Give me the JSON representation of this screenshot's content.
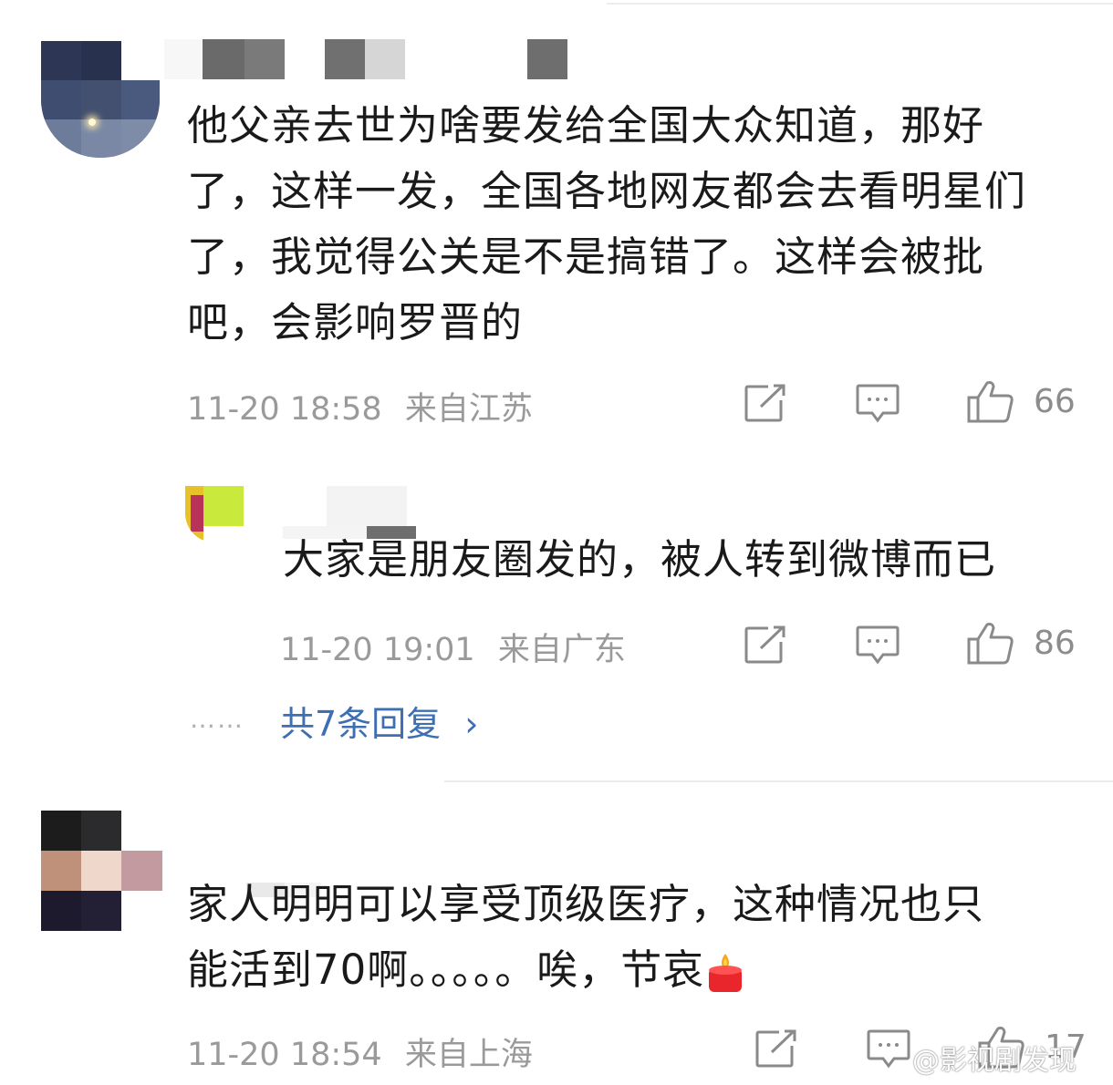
{
  "comments": [
    {
      "text_lines": [
        "他父亲去世为啥要发给全国大众知道，那好",
        "了，这样一发，全国各地网友都会去看明星们",
        "了，我觉得公关是不是搞错了。这样会被批",
        "吧，会影响罗晋的"
      ],
      "time": "11-20 18:58",
      "location": "来自江苏",
      "likes": "66"
    },
    {
      "text_lines": [
        "大家是朋友圈发的，被人转到微博而已"
      ],
      "time": "11-20 19:01",
      "location": "来自广东",
      "likes": "86"
    },
    {
      "text_lines": [
        "家人明明可以享受顶级医疗，这种情况也只",
        "能活到70啊。。。。。唉，节哀"
      ],
      "time": "11-20 18:54",
      "location": "来自上海",
      "likes": "17"
    }
  ],
  "reply_summary": {
    "dots": "……",
    "label": "共7条回复",
    "chevron": "›"
  },
  "watermark": "@影视剧发现",
  "icons": [
    "share-icon",
    "comment-icon",
    "like-icon",
    "candle-emoji"
  ],
  "colors": {
    "link": "#3f6fb3",
    "meta": "#9a9a9a",
    "text": "#1a1a1a"
  }
}
